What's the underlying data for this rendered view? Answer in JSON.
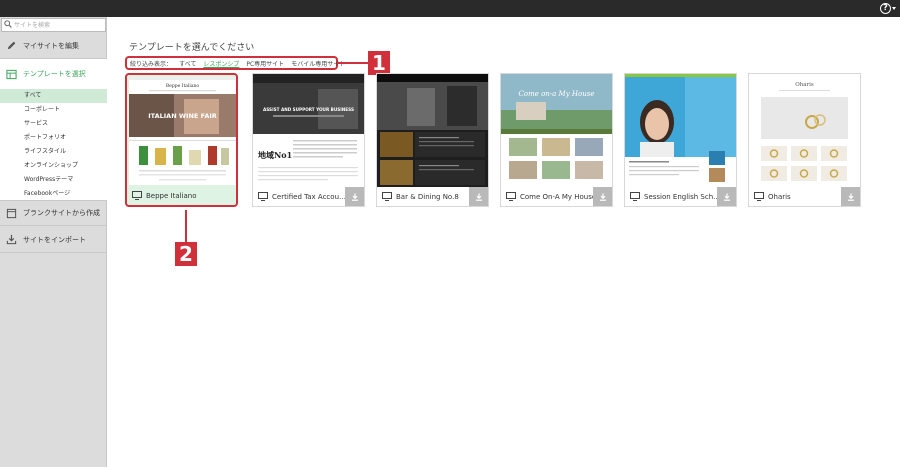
{
  "sidebar": {
    "search_placeholder": "サイトを検索",
    "edit_label": "マイサイトを編集",
    "select_label": "テンプレートを選択",
    "sub_items": [
      "すべて",
      "コーポレート",
      "サービス",
      "ポートフォリオ",
      "ライフスタイル",
      "オンラインショップ",
      "WordPressテーマ",
      "Facebookページ"
    ],
    "blank_label": "ブランクサイトから作成",
    "import_label": "サイトをインポート"
  },
  "main": {
    "title": "テンプレートを選んでください",
    "filter": {
      "label": "絞り込み表示：",
      "items": [
        "すべて",
        "レスポンシブ",
        "PC専用サイト",
        "モバイル専用サイト"
      ],
      "active": "レスポンシブ"
    },
    "badges": [
      "1",
      "2"
    ],
    "templates": [
      {
        "name": "Beppe Italiano",
        "selected": true
      },
      {
        "name": "Certified Tax Accountant"
      },
      {
        "name": "Bar & Dining No.8"
      },
      {
        "name": "Come On-A My House"
      },
      {
        "name": "Session English School"
      },
      {
        "name": "Oharis"
      }
    ],
    "thumb_text": {
      "t1_logo": "Beppe Italiano",
      "t1_headline": "ITALIAN WINE FAIR",
      "t2_headline": "ASSIST AND SUPPORT YOUR BUSINESS",
      "t2_kanji": "地域No1",
      "t4_script": "Come on-a My House",
      "t6_logo": "Oharis"
    }
  },
  "colors": {
    "accent_green": "#3aa55a",
    "annotation_red": "#d0303a",
    "selected_bg": "#dff3e5"
  },
  "icons": {
    "help": "question-circle-icon",
    "search": "search-icon",
    "edit": "pencil-icon",
    "select": "grid-icon",
    "blank": "blank-page-icon",
    "import": "import-icon",
    "monitor": "monitor-icon",
    "download": "download-icon"
  }
}
